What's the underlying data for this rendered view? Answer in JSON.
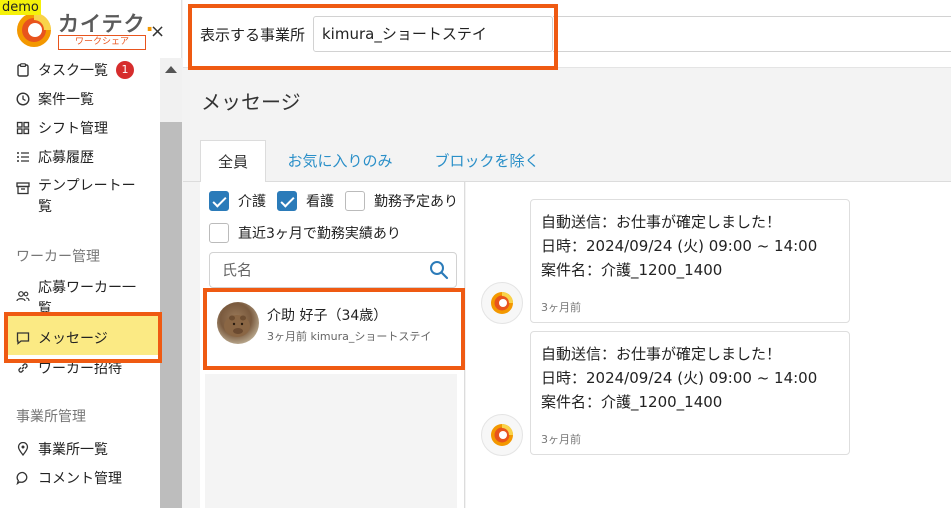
{
  "demo_label": "demo",
  "brand": {
    "name": "カイテク",
    "dot": ".",
    "sub": "ワークシェア",
    "close": "×"
  },
  "sidebar": {
    "items": [
      {
        "label": "タスク一覧",
        "icon": "clipboard-icon",
        "badge": "1"
      },
      {
        "label": "案件一覧",
        "icon": "clock-icon"
      },
      {
        "label": "シフト管理",
        "icon": "grid-icon"
      },
      {
        "label": "応募履歴",
        "icon": "list-icon"
      },
      {
        "label": "テンプレートー",
        "label2": "覧",
        "icon": "archive-icon"
      }
    ],
    "section_worker": "ワーカー管理",
    "worker_items": [
      {
        "label": "応募ワーカー一",
        "label2": "覧",
        "icon": "users-icon"
      },
      {
        "label": "メッセージ",
        "icon": "chat-icon"
      },
      {
        "label": "ワーカー招待",
        "icon": "link-icon"
      }
    ],
    "section_office": "事業所管理",
    "office_items": [
      {
        "label": "事業所一覧",
        "icon": "location-pin-icon"
      },
      {
        "label": "コメント管理",
        "icon": "comment-icon"
      }
    ]
  },
  "topbar": {
    "office_label": "表示する事業所",
    "office_value": "kimura_ショートステイ"
  },
  "page_title": "メッセージ",
  "tabs": [
    {
      "label": "全員",
      "active": true
    },
    {
      "label": "お気に入りのみ"
    },
    {
      "label": "ブロックを除く"
    }
  ],
  "filters": [
    {
      "label": "介護",
      "checked": true
    },
    {
      "label": "看護",
      "checked": true
    },
    {
      "label": "勤務予定あり",
      "checked": false
    },
    {
      "label": "直近3ヶ月で勤務実績あり",
      "checked": false
    }
  ],
  "search": {
    "placeholder": "氏名"
  },
  "workers": [
    {
      "name": "介助 好子（34歳）",
      "sub": "3ヶ月前 kimura_ショートステイ"
    }
  ],
  "messages": [
    {
      "line1": "自動送信：お仕事が確定しました！",
      "line2": "日時：2024/09/24 (火) 09:00 ~ 14:00",
      "line3": "案件名：介護_1200_1400",
      "time": "3ヶ月前"
    },
    {
      "line1": "自動送信：お仕事が確定しました！",
      "line2": "日時：2024/09/24 (火) 09:00 ~ 14:00",
      "line3": "案件名：介護_1200_1400",
      "time": "3ヶ月前"
    }
  ],
  "colors": {
    "accent": "#ef5a12",
    "brand_orange": "#f39800",
    "link": "#2a8fc8",
    "checkbox": "#2b7bb9",
    "active_nav": "#fbea84",
    "badge": "#d62d2d"
  }
}
